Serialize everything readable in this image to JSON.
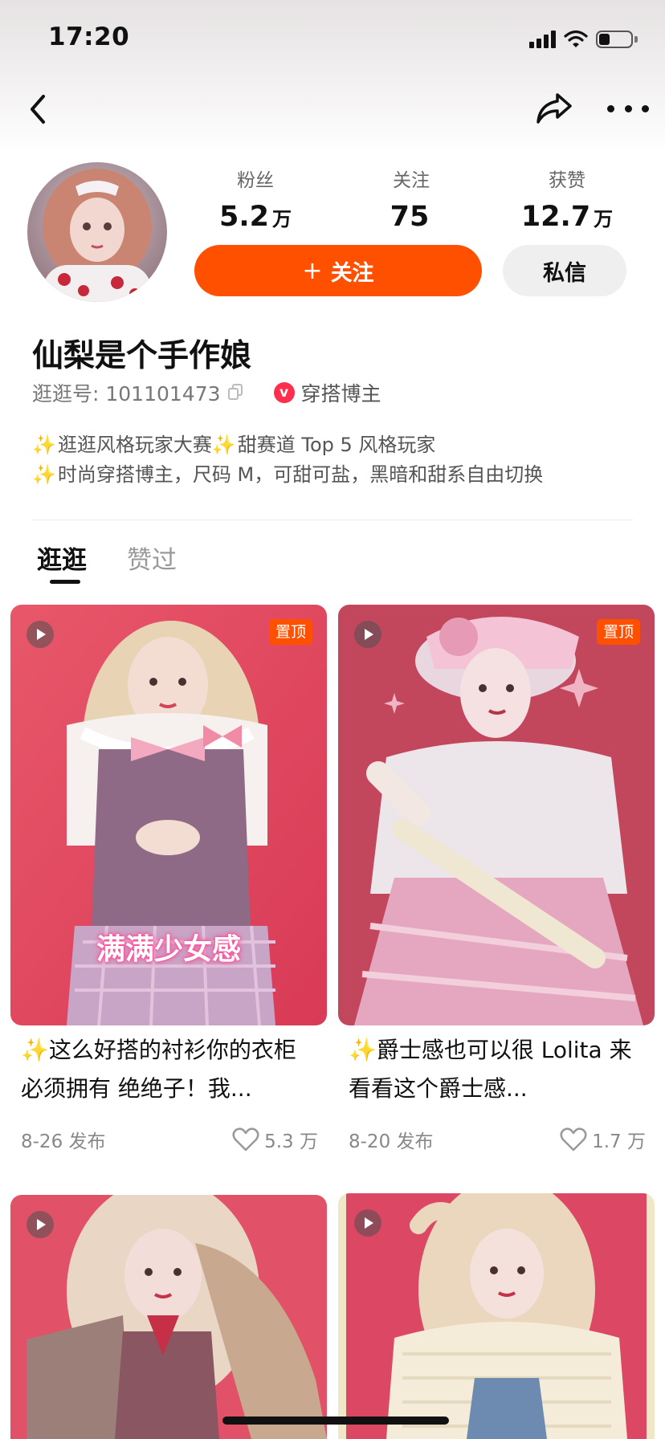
{
  "status_bar": {
    "time": "17:20"
  },
  "nav": {
    "back_icon": "chevron-left-icon",
    "share_icon": "share-arrow-icon",
    "more_icon": "more-dots-icon"
  },
  "profile": {
    "stats": [
      {
        "label": "粉丝",
        "value": "5.2",
        "unit": "万"
      },
      {
        "label": "关注",
        "value": "75",
        "unit": ""
      },
      {
        "label": "获赞",
        "value": "12.7",
        "unit": "万"
      }
    ],
    "follow_button": {
      "plus": "+",
      "label": "关注"
    },
    "message_button": "私信",
    "username": "仙梨是个手作娘",
    "id_text": "逛逛号: 101101473",
    "tag": {
      "badge": "v",
      "label": "穿搭博主"
    },
    "bio": [
      {
        "spark1": "✨",
        "text1": "逛逛风格玩家大赛",
        "spark2": "✨",
        "text2": "甜赛道 Top 5 风格玩家"
      },
      {
        "spark1": "✨",
        "text1": "时尚穿搭博主，尺码 M，可甜可盐，黑暗和甜系自由切换"
      }
    ]
  },
  "tabs": [
    {
      "label": "逛逛",
      "active": true
    },
    {
      "label": "赞过",
      "active": false
    }
  ],
  "cards": [
    {
      "pinned": "置顶",
      "overlay": "满满少女感",
      "title": "✨这么好搭的衬衫你的衣柜必须拥有 绝绝子！我...",
      "date": "8-26 发布",
      "likes": "5.3 万"
    },
    {
      "pinned": "置顶",
      "overlay": "",
      "title": "✨爵士感也可以很 Lolita 来看看这个爵士感...",
      "date": "8-20 发布",
      "likes": "1.7 万"
    },
    {
      "pinned": "",
      "overlay": "",
      "title": "",
      "date": "",
      "likes": ""
    },
    {
      "pinned": "",
      "overlay": "",
      "title": "",
      "date": "",
      "likes": ""
    }
  ],
  "colors": {
    "accent": "#ff5000",
    "tag_red": "#ff2e4d"
  }
}
